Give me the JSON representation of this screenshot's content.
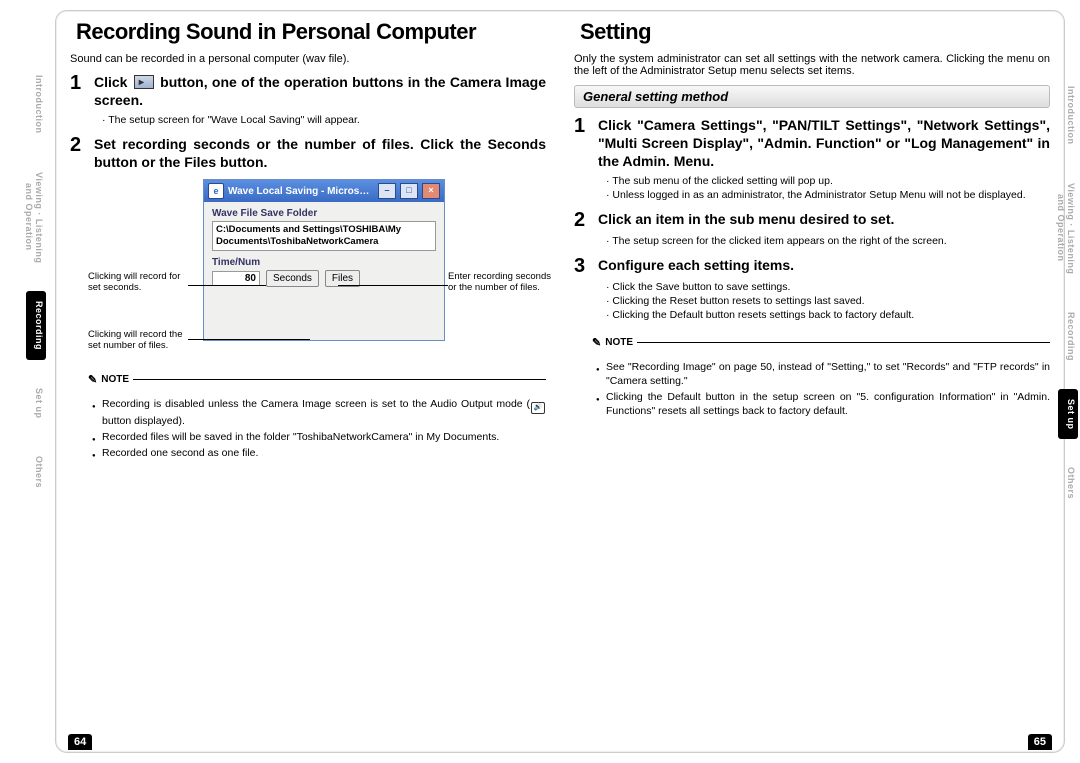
{
  "left": {
    "title": "Recording Sound in Personal Computer",
    "intro": "Sound can be recorded in a personal computer (wav file).",
    "step1_a": "Click",
    "step1_b": "button, one of the operation buttons in the Camera Image screen.",
    "step1_sub": "The setup screen for \"Wave Local Saving\" will appear.",
    "step2": "Set recording seconds or the number of files. Click the Seconds button or the Files button.",
    "dialog": {
      "title": "Wave Local Saving - Microsoft I…",
      "label1": "Wave File Save Folder",
      "path1": "C:\\Documents and Settings\\TOSHIBA\\My",
      "path2": "Documents\\ToshibaNetworkCamera",
      "label2": "Time/Num",
      "num": "80",
      "btn1": "Seconds",
      "btn2": "Files"
    },
    "callout1": "Clicking will record for set seconds.",
    "callout2": "Clicking will record the set number of files.",
    "callout3": "Enter recording seconds or the number of files.",
    "note_label": "NOTE",
    "notes": [
      "Recording is disabled unless the Camera Image screen is set to the Audio Output mode (🔊 button displayed).",
      "Recorded files will be saved in the folder \"ToshibaNetworkCamera\" in My Documents.",
      "Recorded one second as one file."
    ],
    "pagenum": "64"
  },
  "right": {
    "title": "Setting",
    "intro": "Only the system administrator can set all settings with the network camera. Clicking the menu on the left of the Administrator Setup menu selects set items.",
    "subheader": "General setting method",
    "step1": "Click \"Camera Settings\", \"PAN/TILT Settings\", \"Network Settings\", \"Multi Screen Display\", \"Admin. Function\" or \"Log Management\" in the Admin. Menu.",
    "step1_subs": [
      "The sub menu of the clicked setting will pop up.",
      "Unless logged in as an administrator, the Administrator Setup Menu will not be displayed."
    ],
    "step2": "Click an item in the sub menu desired to set.",
    "step2_sub": "The setup screen for the clicked item appears on the right of the screen.",
    "step3": "Configure each setting items.",
    "step3_subs": [
      "Click the Save button to save settings.",
      "Clicking the Reset button resets to settings last saved.",
      "Clicking the Default button resets settings back to factory default."
    ],
    "note_label": "NOTE",
    "notes": [
      "See \"Recording Image\" on page 50, instead of \"Setting,\" to set \"Records\" and \"FTP records\" in \"Camera setting.\"",
      "Clicking the Default button in the setup screen on \"5. configuration Information\" in \"Admin. Functions\" resets all settings back to factory default."
    ],
    "pagenum": "65"
  },
  "tabs": {
    "t1": "Introduction",
    "t2a": "Viewing · Listening",
    "t2b": "and Operation",
    "t3": "Recording",
    "t4": "Set up",
    "t5": "Others"
  }
}
